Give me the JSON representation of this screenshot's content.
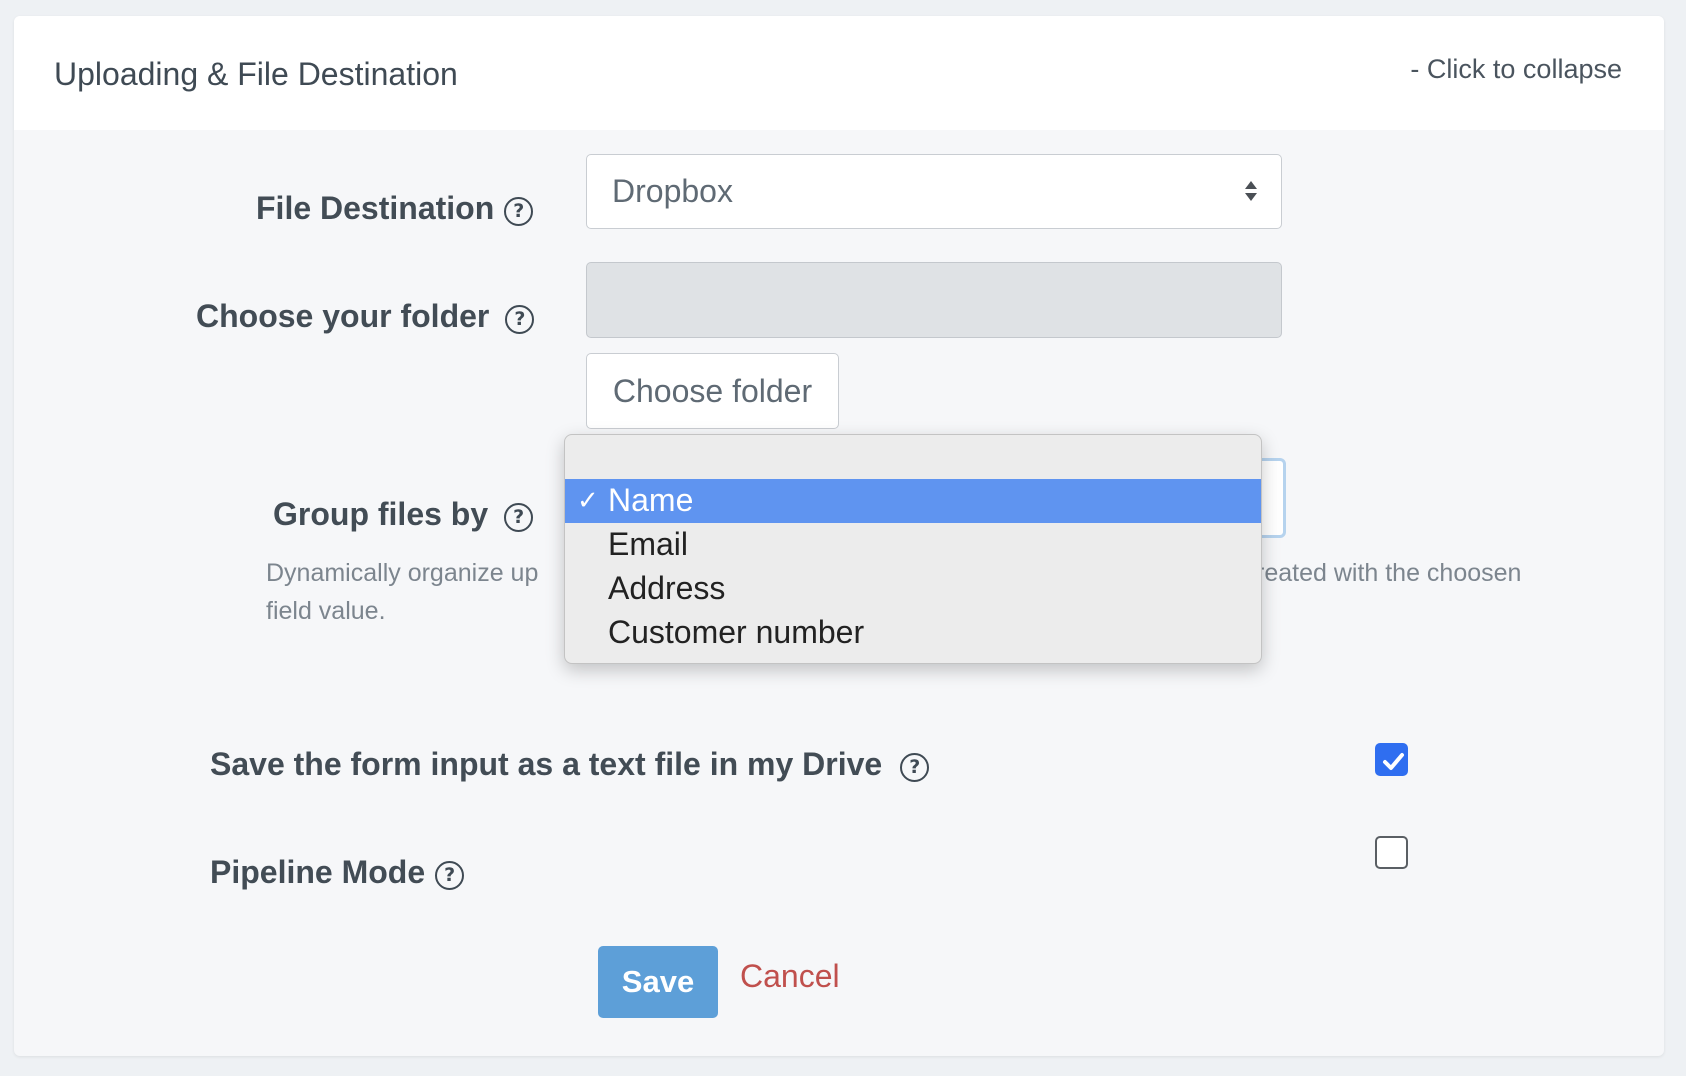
{
  "panel": {
    "title": "Uploading & File Destination",
    "collapse_label": "- Click to collapse"
  },
  "file_destination": {
    "label": "File Destination",
    "value": "Dropbox"
  },
  "folder": {
    "label": "Choose your folder",
    "value": "",
    "button_label": "Choose folder"
  },
  "group_files": {
    "label": "Group files by",
    "selected": "Name",
    "options": [
      "Name",
      "Email",
      "Address",
      "Customer number"
    ],
    "hint_left": "Dynamically organize up",
    "hint_right": "reated with the choosen",
    "hint_line2": "field value."
  },
  "save_text_file": {
    "label": "Save the form input as a text file in my Drive",
    "checked": true
  },
  "pipeline_mode": {
    "label": "Pipeline Mode",
    "checked": false
  },
  "actions": {
    "save_label": "Save",
    "cancel_label": "Cancel"
  },
  "colors": {
    "accent": "#5d9fd8",
    "checkbox_checked": "#2f6ef0",
    "dropdown_highlight": "#5f94f0",
    "cancel": "#c0504d"
  },
  "icons": {
    "help": "question-circle-icon",
    "select_arrows": "sort-arrows-icon",
    "checkmark": "check-icon"
  }
}
